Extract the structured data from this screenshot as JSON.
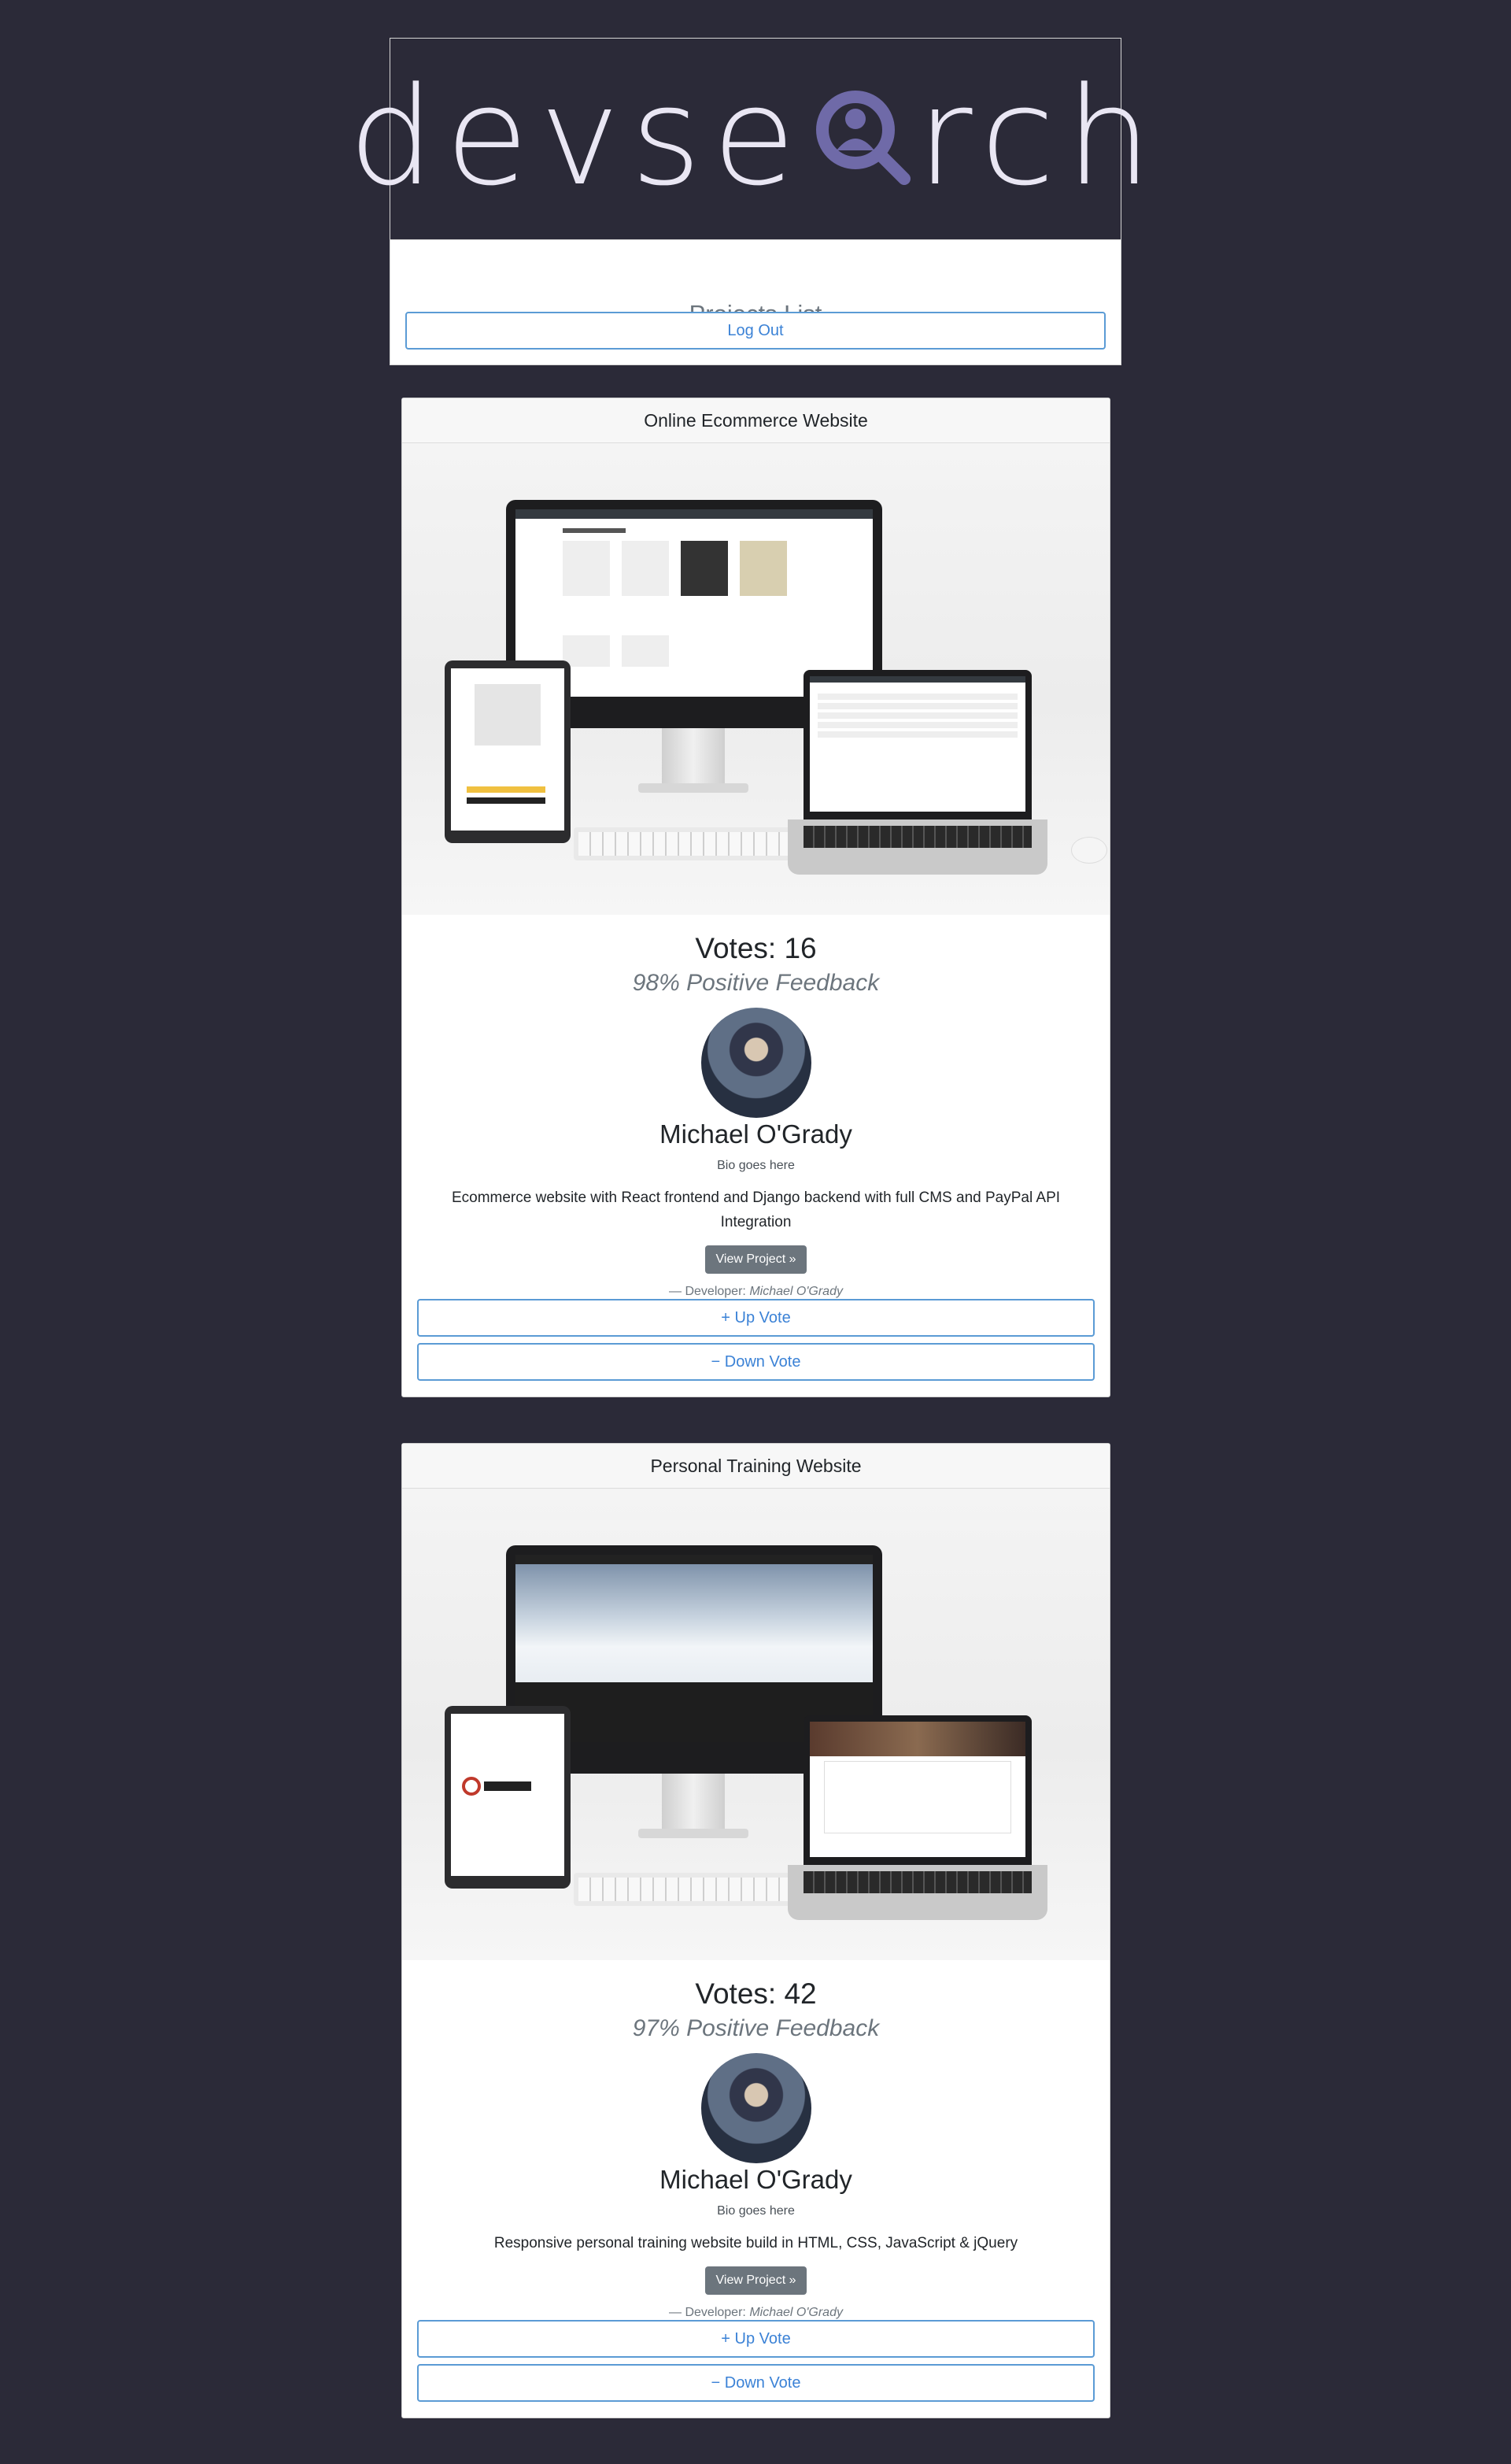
{
  "header": {
    "logo_text": "devsearch",
    "page_title": "Projects List",
    "logout_label": "Log Out"
  },
  "projects": [
    {
      "title": "Online Ecommerce Website",
      "votes": "Votes: 16",
      "feedback": "98% Positive Feedback",
      "developer_name": "Michael O'Grady",
      "bio": "Bio goes here",
      "description": "Ecommerce website with React frontend and Django backend with full CMS and PayPal API Integration",
      "view_label": "View Project »",
      "credit_prefix": "— Developer:",
      "credit_name": "Michael O'Grady",
      "upvote_label": "+ Up Vote",
      "downvote_label": "− Down Vote"
    },
    {
      "title": "Personal Training Website",
      "votes": "Votes: 42",
      "feedback": "97% Positive Feedback",
      "developer_name": "Michael O'Grady",
      "bio": "Bio goes here",
      "description": "Responsive personal training website build in HTML, CSS, JavaScript & jQuery",
      "view_label": "View Project »",
      "credit_prefix": "— Developer:",
      "credit_name": "Michael O'Grady",
      "upvote_label": "+ Up Vote",
      "downvote_label": "− Down Vote"
    }
  ],
  "colors": {
    "page_bg": "#2b2a38",
    "accent": "#5b9bd5",
    "muted": "#6c757d",
    "logo_lens": "#6f6aa8"
  }
}
